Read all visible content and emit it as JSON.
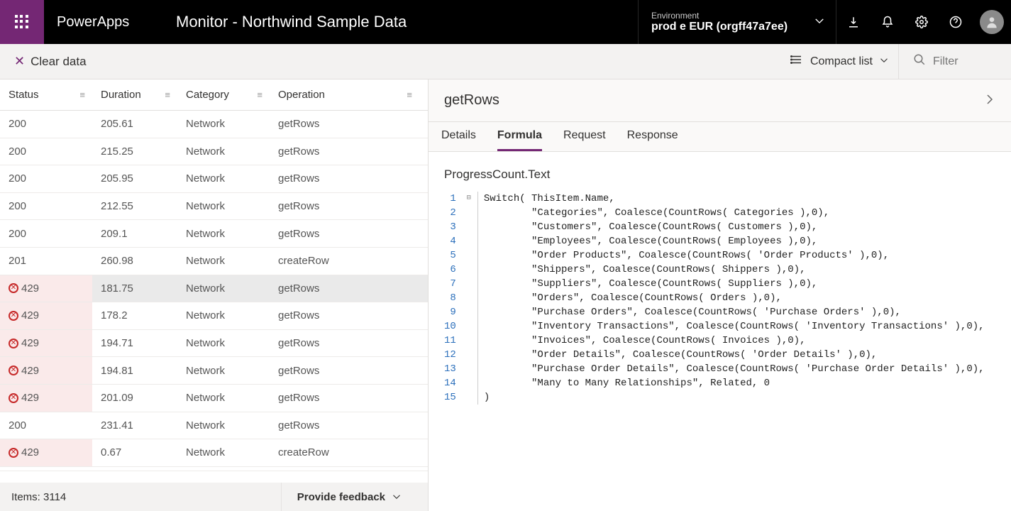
{
  "header": {
    "brand": "PowerApps",
    "page_title": "Monitor - Northwind Sample Data",
    "env_label": "Environment",
    "env_name": "prod e EUR (orgff47a7ee)"
  },
  "cmdbar": {
    "clear_data": "Clear data",
    "compact_list": "Compact list",
    "filter_placeholder": "Filter"
  },
  "table": {
    "columns": {
      "status": "Status",
      "duration": "Duration",
      "category": "Category",
      "operation": "Operation"
    },
    "rows": [
      {
        "status": "200",
        "error": false,
        "duration": "205.61",
        "category": "Network",
        "operation": "getRows",
        "selected": false
      },
      {
        "status": "200",
        "error": false,
        "duration": "215.25",
        "category": "Network",
        "operation": "getRows",
        "selected": false
      },
      {
        "status": "200",
        "error": false,
        "duration": "205.95",
        "category": "Network",
        "operation": "getRows",
        "selected": false
      },
      {
        "status": "200",
        "error": false,
        "duration": "212.55",
        "category": "Network",
        "operation": "getRows",
        "selected": false
      },
      {
        "status": "200",
        "error": false,
        "duration": "209.1",
        "category": "Network",
        "operation": "getRows",
        "selected": false
      },
      {
        "status": "201",
        "error": false,
        "duration": "260.98",
        "category": "Network",
        "operation": "createRow",
        "selected": false
      },
      {
        "status": "429",
        "error": true,
        "duration": "181.75",
        "category": "Network",
        "operation": "getRows",
        "selected": true
      },
      {
        "status": "429",
        "error": true,
        "duration": "178.2",
        "category": "Network",
        "operation": "getRows",
        "selected": false
      },
      {
        "status": "429",
        "error": true,
        "duration": "194.71",
        "category": "Network",
        "operation": "getRows",
        "selected": false
      },
      {
        "status": "429",
        "error": true,
        "duration": "194.81",
        "category": "Network",
        "operation": "getRows",
        "selected": false
      },
      {
        "status": "429",
        "error": true,
        "duration": "201.09",
        "category": "Network",
        "operation": "getRows",
        "selected": false
      },
      {
        "status": "200",
        "error": false,
        "duration": "231.41",
        "category": "Network",
        "operation": "getRows",
        "selected": false
      },
      {
        "status": "429",
        "error": true,
        "duration": "0.67",
        "category": "Network",
        "operation": "createRow",
        "selected": false
      }
    ],
    "footer_items": "Items: 3114",
    "feedback": "Provide feedback"
  },
  "detail": {
    "title": "getRows",
    "tabs": {
      "details": "Details",
      "formula": "Formula",
      "request": "Request",
      "response": "Response"
    },
    "active_tab": "formula",
    "property": "ProgressCount.Text",
    "code_lines": [
      "Switch( ThisItem.Name,",
      "        \"Categories\", Coalesce(CountRows( Categories ),0),",
      "        \"Customers\", Coalesce(CountRows( Customers ),0),",
      "        \"Employees\", Coalesce(CountRows( Employees ),0),",
      "        \"Order Products\", Coalesce(CountRows( 'Order Products' ),0),",
      "        \"Shippers\", Coalesce(CountRows( Shippers ),0),",
      "        \"Suppliers\", Coalesce(CountRows( Suppliers ),0),",
      "        \"Orders\", Coalesce(CountRows( Orders ),0),",
      "        \"Purchase Orders\", Coalesce(CountRows( 'Purchase Orders' ),0),",
      "        \"Inventory Transactions\", Coalesce(CountRows( 'Inventory Transactions' ),0),",
      "        \"Invoices\", Coalesce(CountRows( Invoices ),0),",
      "        \"Order Details\", Coalesce(CountRows( 'Order Details' ),0),",
      "        \"Purchase Order Details\", Coalesce(CountRows( 'Purchase Order Details' ),0),",
      "        \"Many to Many Relationships\", Related, 0",
      ")"
    ]
  }
}
